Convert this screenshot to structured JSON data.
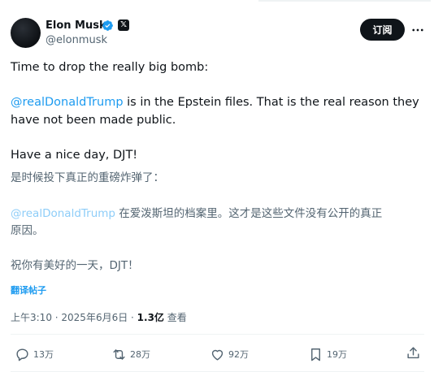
{
  "author": {
    "name": "Elon Musk",
    "handle": "@elonmusk",
    "x_badge": "𝕏",
    "verified_color": "#1d9bf0"
  },
  "subscribe_label": "订阅",
  "more_icon": "more-horizontal-icon",
  "tweet": {
    "line1": "Time to drop the really big bomb:",
    "mention": "@realDonaldTrump",
    "line2_rest": " is in the Epstein files. That is the real reason they",
    "line3": "have not been made public.",
    "line4": "Have a nice day, DJT!"
  },
  "translation": {
    "line1": "是时候投下真正的重磅炸弹了：",
    "mention": "@realDonaldTrump",
    "line2_rest": " 在爱泼斯坦的档案里。这才是这些文件没有公开的真正",
    "line3": "原因。",
    "line4": "祝你有美好的一天，DJT！"
  },
  "translate_link": "翻译帖子",
  "meta": {
    "time": "上午3:10",
    "sep1": " · ",
    "date": "2025年6月6日",
    "sep2": " · ",
    "views_count": "1.3亿",
    "views_label": " 查看"
  },
  "actions": {
    "replies": "13万",
    "reposts": "28万",
    "likes": "92万",
    "bookmarks": "19万"
  },
  "colors": {
    "accent": "#1d9bf0",
    "text": "#0f1419",
    "muted": "#536471"
  }
}
